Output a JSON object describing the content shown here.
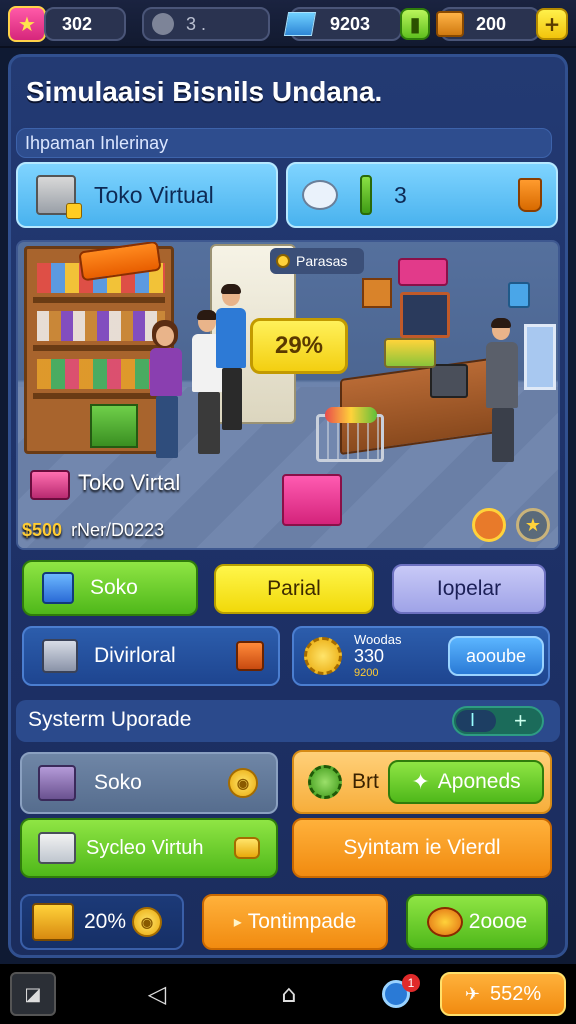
{
  "top": {
    "coins_value": "302",
    "search_value": "3 .",
    "gems_value": "9203",
    "chests_value": "200",
    "add_label": "+"
  },
  "title": "Simulaaisi Bisnils Undana.",
  "subtitle": "Ihpaman Inlerinay",
  "cards": {
    "shop_label": "Toko Virtual",
    "count_value": "3"
  },
  "scene": {
    "sign_label": "Parasas",
    "discount": "29%",
    "name": "Toko Virtal",
    "price": "$500",
    "price_suffix": "rNer/D0223"
  },
  "buttons_row1": {
    "green_label": "Soko",
    "yellow_label": "Parial",
    "lav_label": "Iopelar"
  },
  "buttons_row2": {
    "left_label": "Divirloral",
    "mid_title": "Woodas",
    "mid_value": "330",
    "mid_sub": "9200",
    "right_label": "aooube"
  },
  "upgrade": {
    "title": "Systerm Uporade",
    "toggle_left": "I",
    "toggle_right": "+"
  },
  "upgrade_grid": {
    "a_label": "Soko",
    "b_prefix": "Brt",
    "b_label": "Aponeds",
    "c_label": "Sycleo Virtuh",
    "d_label": "Syintam ie Vierdl"
  },
  "bottom_row": {
    "pct_label": "20%",
    "mid_label": "Tontimpade",
    "right_label": "2oooe"
  },
  "navbar": {
    "badge": "1",
    "promo_label": "552%"
  },
  "colors": {
    "panel": "#233a73",
    "green": "#4fb81a",
    "yellow": "#f1d90a",
    "orange": "#f18b10",
    "accent_blue": "#49b2ee"
  }
}
